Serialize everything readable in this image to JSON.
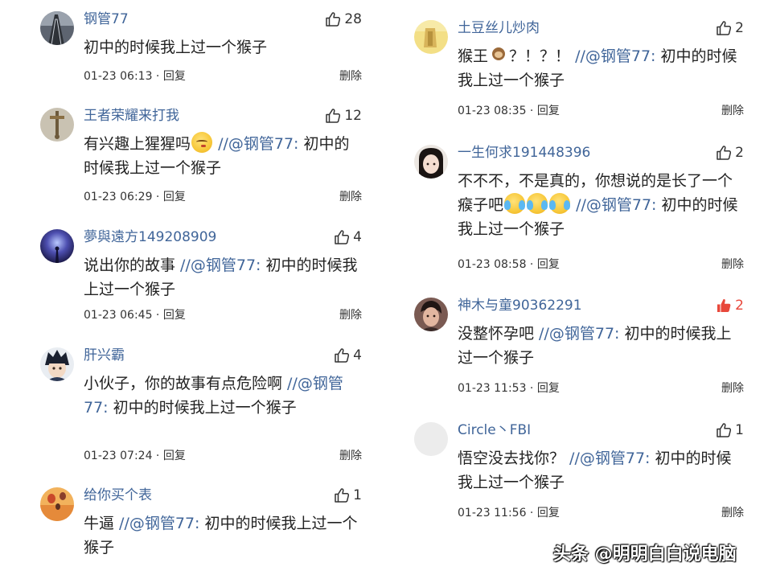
{
  "ui": {
    "reply_label": "回复",
    "delete_label": "删除",
    "like_color": "#e8483b",
    "name_color": "#406599"
  },
  "left": [
    {
      "user": "钢管77",
      "likes": "28",
      "liked": false,
      "text": "初中的时候我上过一个猴子",
      "time": "01-23 06:13",
      "avatar": "tower-avatar"
    },
    {
      "user": "王者荣耀来打我",
      "likes": "12",
      "liked": false,
      "text_before": "有兴趣上猩猩吗",
      "emoji": "sly-face-emoji",
      "mention": "//@钢管77:",
      "text_after": " 初中的时候我上过一个猴子",
      "time": "01-23 06:29",
      "avatar": "sword-avatar"
    },
    {
      "user": "夢與遠方149208909",
      "likes": "4",
      "liked": false,
      "text_before": "说出你的故事 ",
      "mention": "//@钢管77:",
      "text_after": " 初中的时候我上过一个猴子",
      "time": "01-23 06:45",
      "avatar": "night-sky-avatar"
    },
    {
      "user": "肝兴霸",
      "likes": "4",
      "liked": false,
      "text_before": "小伙子，你的故事有点危险啊 ",
      "mention": "//@钢管77:",
      "text_after": " 初中的时候我上过一个猴子",
      "time": "01-23 07:24",
      "avatar": "anime-avatar"
    },
    {
      "user": "给你买个表",
      "likes": "1",
      "liked": false,
      "text_before": "牛逼 ",
      "mention": "//@钢管77:",
      "text_after": " 初中的时候我上过一个猴子",
      "avatar": "balloon-avatar"
    }
  ],
  "right": [
    {
      "user": "土豆丝儿炒肉",
      "likes": "2",
      "liked": false,
      "text_before": "猴王",
      "text_mid": "？！？！ ",
      "mention": "//@钢管77:",
      "text_after": " 初中的时候我上过一个猴子",
      "time": "01-23 08:35",
      "avatar": "yellow-avatar"
    },
    {
      "user": "一生何求191448396",
      "likes": "2",
      "liked": false,
      "text_before": "不不不，不是真的，你想说的是长了一个瘊子吧",
      "mention": "//@钢管77:",
      "text_after": " 初中的时候我上过一个猴子",
      "time": "01-23 08:58",
      "avatar": "girl-avatar"
    },
    {
      "user": "神木与童90362291",
      "likes": "2",
      "liked": true,
      "text_before": "没整怀孕吧 ",
      "mention": "//@钢管77:",
      "text_after": " 初中的时候我上过一个猴子",
      "time": "01-23 11:53",
      "avatar": "man-avatar"
    },
    {
      "user": "Circle丶FBI",
      "likes": "1",
      "liked": false,
      "text_before": "悟空没去找你？ ",
      "mention": "//@钢管77:",
      "text_after": " 初中的时候我上过一个猴子",
      "time": "01-23 11:56",
      "avatar": "blank-avatar"
    }
  ],
  "watermark": "头条 @明明白白说电脑"
}
